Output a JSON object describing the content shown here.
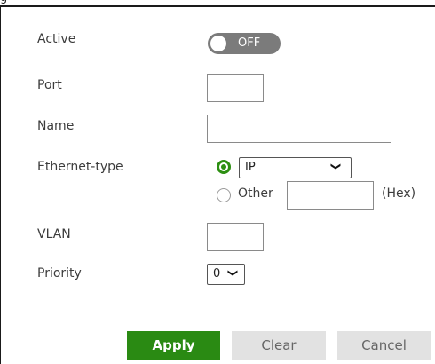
{
  "header_fragment": "g",
  "form": {
    "active": {
      "label": "Active",
      "toggle_text": "OFF",
      "state": "off"
    },
    "port": {
      "label": "Port",
      "value": ""
    },
    "name": {
      "label": "Name",
      "value": ""
    },
    "ethernet_type": {
      "label": "Ethernet-type",
      "ip_option_selected": true,
      "ip_select_value": "IP",
      "other_label": "Other",
      "other_value": "",
      "hex_label": "(Hex)"
    },
    "vlan": {
      "label": "VLAN",
      "value": ""
    },
    "priority": {
      "label": "Priority",
      "value": "0"
    }
  },
  "buttons": {
    "apply": "Apply",
    "clear": "Clear",
    "cancel": "Cancel"
  },
  "colors": {
    "accent": "#2a8a13",
    "toggle_off": "#7b7b7b",
    "secondary_button": "#e2e2e2"
  }
}
